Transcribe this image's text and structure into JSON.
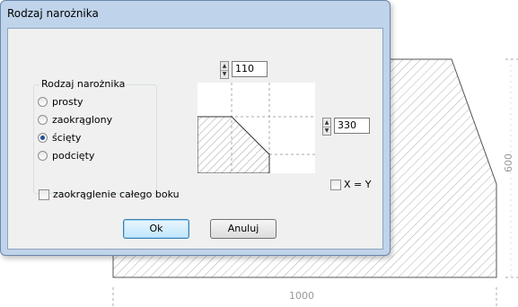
{
  "dialog": {
    "title": "Rodzaj narożnika"
  },
  "corner_type": {
    "legend": "Rodzaj narożnika",
    "options": [
      {
        "label": "prosty",
        "selected": false
      },
      {
        "label": "zaokrąglony",
        "selected": false
      },
      {
        "label": "ścięty",
        "selected": true
      },
      {
        "label": "podcięty",
        "selected": false
      }
    ]
  },
  "top_value": "110",
  "side_value": "330",
  "xy_checkbox": {
    "label": "X = Y",
    "checked": false
  },
  "round_side_checkbox": {
    "label": "zaokrąglenie całego boku",
    "checked": false
  },
  "buttons": {
    "ok": "Ok",
    "cancel": "Anuluj"
  },
  "background_drawing": {
    "width_dimension": "1000",
    "height_dimension": "600"
  },
  "colors": {
    "titlebar": "#bfd3ea",
    "radio_dot": "#1e4f9a",
    "hatch": "#9a9a9a"
  }
}
